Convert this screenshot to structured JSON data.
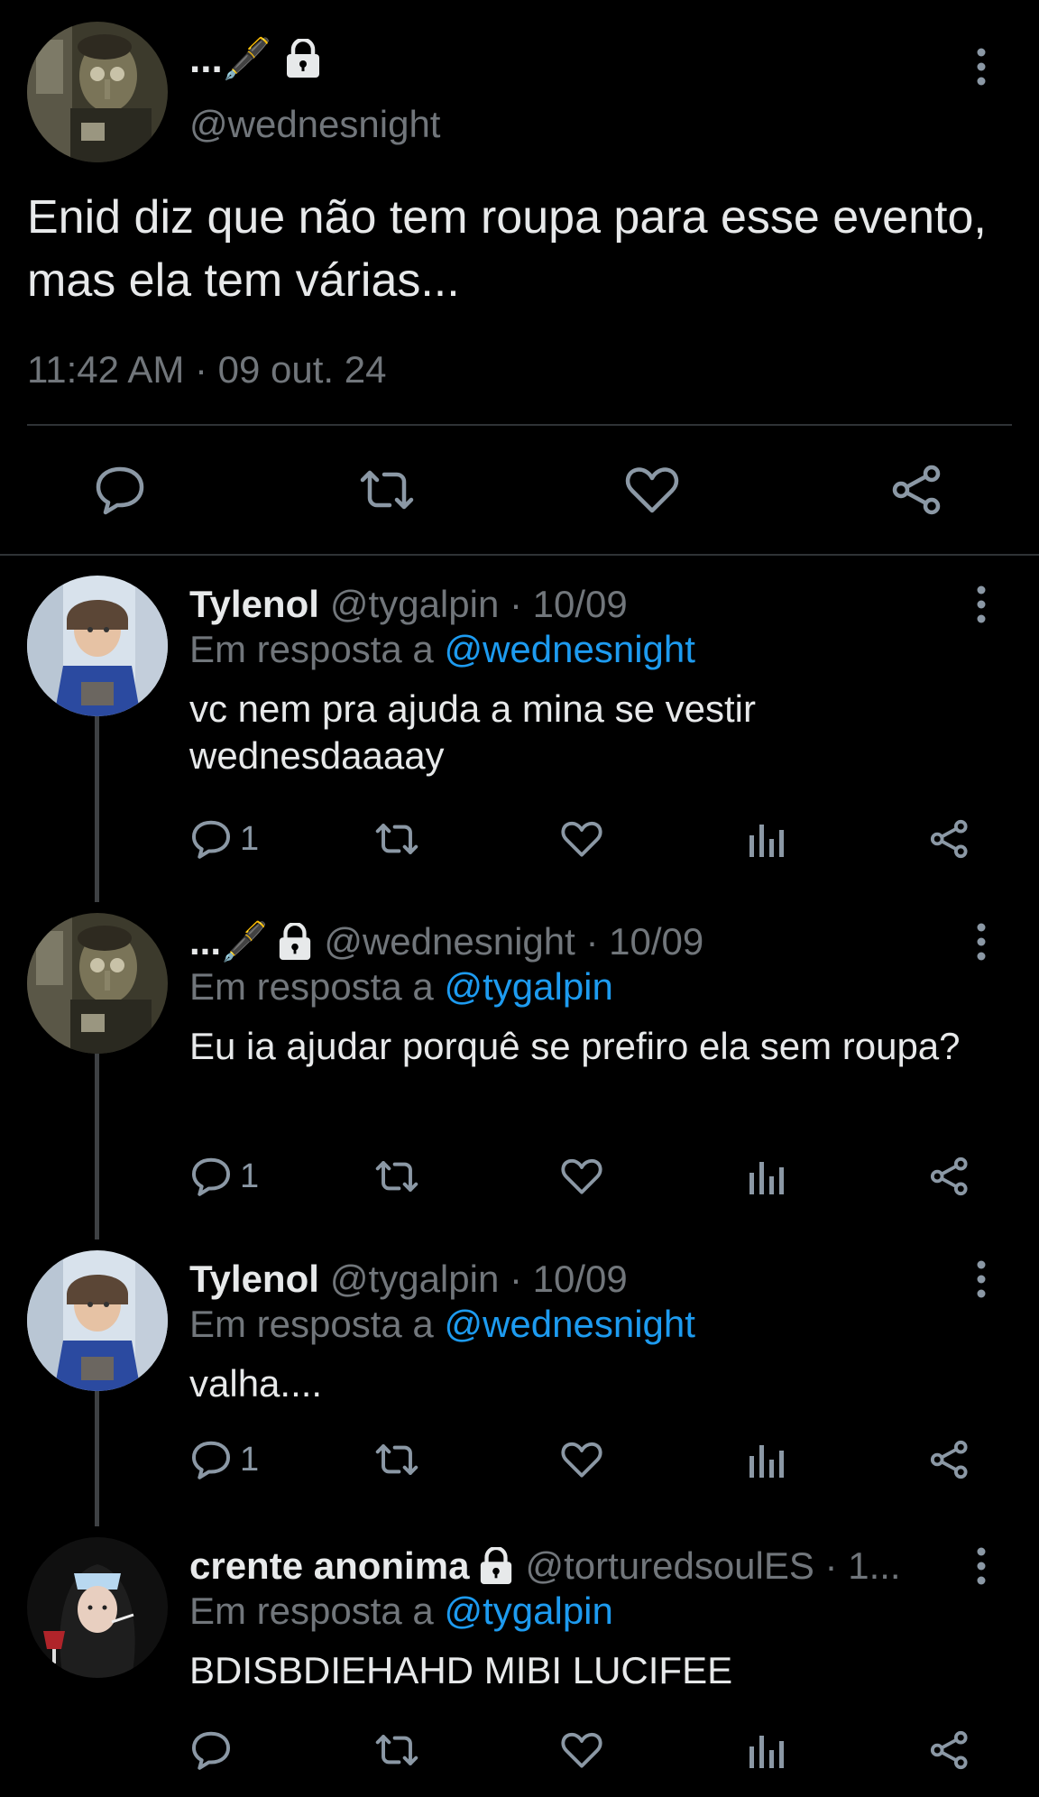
{
  "main_tweet": {
    "display_name": "...🖋️",
    "handle": "@wednesnight",
    "text": "Enid diz que não tem roupa para esse evento, mas ela tem várias...",
    "timestamp": "11:42 AM · 09 out. 24",
    "icons": [
      "avatar-image",
      "lock-icon",
      "more-options-icon",
      "reply-icon",
      "retweet-icon",
      "like-icon",
      "share-icon"
    ]
  },
  "replies": [
    {
      "display_name": "Tylenol",
      "handle_date": "@tygalpin · 10/09",
      "in_reply_prefix": "Em resposta a",
      "in_reply_to": "@wednesnight",
      "text": "vc nem pra ajuda a mina se vestir wednesdaaaay",
      "reply_count": "1",
      "protected": false
    },
    {
      "display_name": "...🖋️",
      "handle_date": "@wednesnight · 10/09",
      "in_reply_prefix": "Em resposta a",
      "in_reply_to": "@tygalpin",
      "text": "Eu ia ajudar porquê se prefiro ela sem roupa?",
      "reply_count": "1",
      "protected": true
    },
    {
      "display_name": "Tylenol",
      "handle_date": "@tygalpin · 10/09",
      "in_reply_prefix": "Em resposta a",
      "in_reply_to": "@wednesnight",
      "text": "valha....",
      "reply_count": "1",
      "protected": false
    },
    {
      "display_name": "crente anonima",
      "handle_date": "@torturedsoulES · 1...",
      "in_reply_prefix": "Em resposta a",
      "in_reply_to": "@tygalpin",
      "text": "BDISBDIEHAHD MIBI LUCIFEE",
      "reply_count": "",
      "protected": true
    }
  ],
  "colors": {
    "background": "#000000",
    "text_primary": "#e7e9ea",
    "text_secondary": "#71767b",
    "mention": "#1d9bf0",
    "icon": "#8b98a5",
    "divider": "#2f3336"
  }
}
